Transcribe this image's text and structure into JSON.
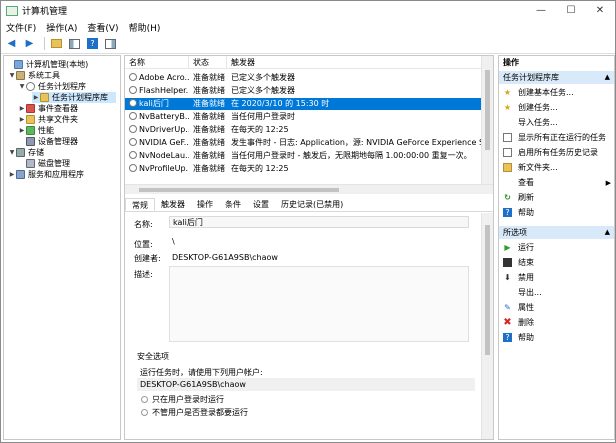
{
  "window": {
    "title": "计算机管理"
  },
  "menu": [
    "文件(F)",
    "操作(A)",
    "查看(V)",
    "帮助(H)"
  ],
  "tree": [
    {
      "label": "计算机管理(本地)",
      "level": 0,
      "icon": "computer-icon"
    },
    {
      "label": "系统工具",
      "level": 1,
      "icon": "tools-icon"
    },
    {
      "label": "任务计划程序",
      "level": 2,
      "icon": "clock-icon"
    },
    {
      "label": "任务计划程序库",
      "level": 3,
      "icon": "folder-icon",
      "selected": true
    },
    {
      "label": "事件查看器",
      "level": 2,
      "icon": "event-icon"
    },
    {
      "label": "共享文件夹",
      "level": 2,
      "icon": "folder-icon"
    },
    {
      "label": "性能",
      "level": 2,
      "icon": "performance-icon"
    },
    {
      "label": "设备管理器",
      "level": 2,
      "icon": "device-icon"
    },
    {
      "label": "存储",
      "level": 1,
      "icon": "storage-icon"
    },
    {
      "label": "磁盘管理",
      "level": 2,
      "icon": "disk-icon"
    },
    {
      "label": "服务和应用程序",
      "level": 1,
      "icon": "services-icon"
    }
  ],
  "grid": {
    "columns": [
      "名称",
      "状态",
      "触发器"
    ],
    "rows": [
      {
        "name": "Adobe Acro...",
        "status": "准备就绪",
        "trigger": "已定义多个触发器"
      },
      {
        "name": "FlashHelper...",
        "status": "准备就绪",
        "trigger": "已定义多个触发器"
      },
      {
        "name": "kali后门",
        "status": "准备就绪",
        "trigger": "在 2020/3/10 的 15:30 时",
        "selected": true
      },
      {
        "name": "NvBatteryB...",
        "status": "准备就绪",
        "trigger": "当任何用户登录时"
      },
      {
        "name": "NvDriverUp...",
        "status": "准备就绪",
        "trigger": "在每天的 12:25"
      },
      {
        "name": "NVIDIA GeF...",
        "status": "准备就绪",
        "trigger": "发生事件时 - 日志: Application，源: NVIDIA GeForce Experience SelfUpdat"
      },
      {
        "name": "NvNodeLau...",
        "status": "准备就绪",
        "trigger": "当任何用户登录时 - 触发后，无限期地每隔 1.00:00:00 重复一次。"
      },
      {
        "name": "NvProfileUp...",
        "status": "准备就绪",
        "trigger": "在每天的 12:25"
      }
    ]
  },
  "tabs": [
    "常规",
    "触发器",
    "操作",
    "条件",
    "设置",
    "历史记录(已禁用)"
  ],
  "detail": {
    "name_label": "名称:",
    "name_value": "kali后门",
    "location_label": "位置:",
    "location_value": "\\",
    "author_label": "创建者:",
    "author_value": "DESKTOP-G61A9SB\\chaow",
    "desc_label": "描述:",
    "security_title": "安全选项",
    "run_as_label": "运行任务时，请使用下列用户帐户:",
    "run_as_value": "DESKTOP-G61A9SB\\chaow",
    "radio1": "只在用户登录时运行",
    "radio2": "不管用户是否登录都要运行"
  },
  "actions": {
    "title": "操作",
    "section1": "任务计划程序库",
    "items1": [
      {
        "label": "创建基本任务...",
        "icon": "create-basic-task-icon"
      },
      {
        "label": "创建任务...",
        "icon": "create-task-icon"
      },
      {
        "label": "导入任务...",
        "icon": "blank-icon"
      },
      {
        "label": "显示所有正在运行的任务",
        "icon": "running-tasks-icon"
      },
      {
        "label": "启用所有任务历史记录",
        "icon": "history-icon"
      },
      {
        "label": "新文件夹...",
        "icon": "new-folder-icon"
      },
      {
        "label": "查看",
        "icon": "blank-icon",
        "submenu": true
      },
      {
        "label": "刷新",
        "icon": "refresh-icon"
      },
      {
        "label": "帮助",
        "icon": "help-icon"
      }
    ],
    "section2": "所选项",
    "items2": [
      {
        "label": "运行",
        "icon": "run-icon"
      },
      {
        "label": "结束",
        "icon": "end-icon"
      },
      {
        "label": "禁用",
        "icon": "disable-icon"
      },
      {
        "label": "导出...",
        "icon": "blank-icon"
      },
      {
        "label": "属性",
        "icon": "properties-icon"
      },
      {
        "label": "删除",
        "icon": "delete-icon"
      },
      {
        "label": "帮助",
        "icon": "help-icon"
      }
    ]
  }
}
